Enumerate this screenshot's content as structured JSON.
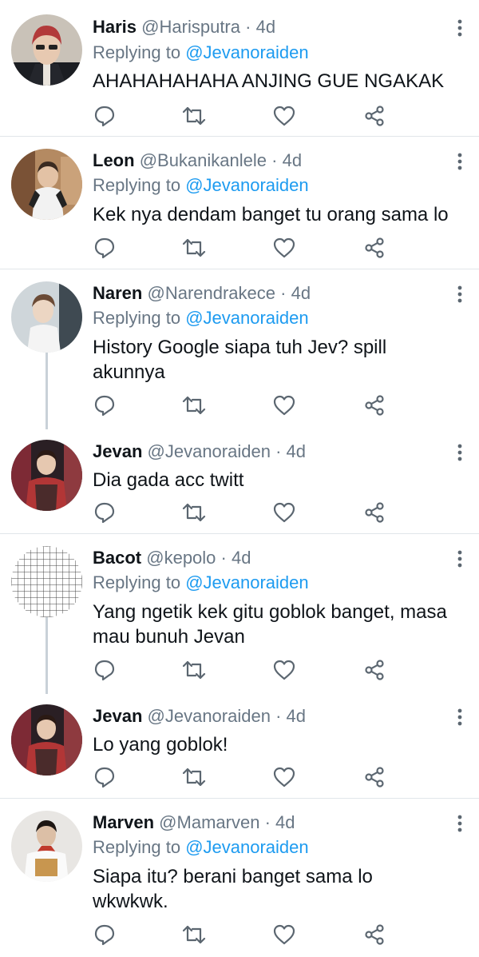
{
  "tweets": [
    {
      "name": "Haris",
      "handle": "@Harisputra",
      "sep": "·",
      "time": "4d",
      "replying_prefix": "Replying to",
      "replying_to": "@Jevanoraiden",
      "text": "AHAHAHAHAHA ANJING GUE NGAKAK"
    },
    {
      "name": "Leon",
      "handle": "@Bukanikanlele",
      "sep": "·",
      "time": "4d",
      "replying_prefix": "Replying to",
      "replying_to": "@Jevanoraiden",
      "text": "Kek nya dendam banget tu orang sama lo"
    },
    {
      "name": "Naren",
      "handle": "@Narendrakece",
      "sep": "·",
      "time": "4d",
      "replying_prefix": "Replying to",
      "replying_to": "@Jevanoraiden",
      "text": "History Google siapa tuh Jev? spill akunnya"
    },
    {
      "name": "Jevan",
      "handle": "@Jevanoraiden",
      "sep": "·",
      "time": "4d",
      "text": "Dia gada acc twitt"
    },
    {
      "name": "Bacot",
      "handle": "@kepolo",
      "sep": "·",
      "time": "4d",
      "replying_prefix": "Replying to",
      "replying_to": "@Jevanoraiden",
      "text": "Yang ngetik kek gitu goblok banget, masa mau bunuh Jevan"
    },
    {
      "name": "Jevan",
      "handle": "@Jevanoraiden",
      "sep": "·",
      "time": "4d",
      "text": "Lo yang goblok!"
    },
    {
      "name": "Marven",
      "handle": "@Mamarven",
      "sep": "·",
      "time": "4d",
      "replying_prefix": "Replying to",
      "replying_to": "@Jevanoraiden",
      "text": "Siapa itu? berani banget sama lo wkwkwk."
    }
  ],
  "icons": {
    "reply": "reply-icon",
    "retweet": "retweet-icon",
    "like": "heart-icon",
    "share": "share-icon",
    "more": "more-vertical-icon"
  },
  "colors": {
    "mention": "#1d9bf0",
    "secondary": "#687684",
    "icon": "#5b6670",
    "separator": "#e1e6ea"
  }
}
